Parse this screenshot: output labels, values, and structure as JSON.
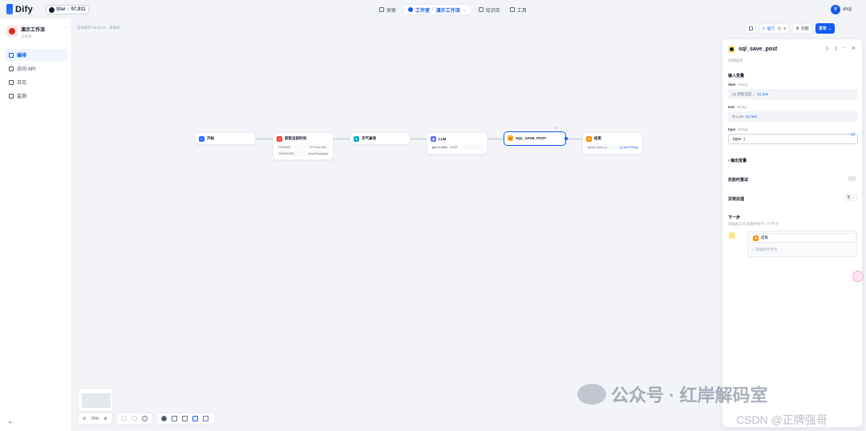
{
  "brand": {
    "name": "Dify",
    "star_label": "Star",
    "star_count": "97,911"
  },
  "nav": {
    "search": "探索",
    "studio": "工作室",
    "app_crumb": "演示工作流",
    "knowledge": "知识库",
    "tools": "工具"
  },
  "user": {
    "initial": "V",
    "name": "vhql"
  },
  "sidebar": {
    "app_name": "演示工作流",
    "app_type": "工作流",
    "items": [
      {
        "label": "编排",
        "icon": "layout-icon"
      },
      {
        "label": "访问 API",
        "icon": "api-icon"
      },
      {
        "label": "日志",
        "icon": "log-icon"
      },
      {
        "label": "监测",
        "icon": "monitor-icon"
      }
    ]
  },
  "canvas": {
    "autosave": "自动保存 09:24:11 · 未发布",
    "toolbar": {
      "run": "运行",
      "features": "功能",
      "publish": "发布"
    },
    "zoom": "76%"
  },
  "nodes": [
    {
      "id": "start",
      "title": "开始",
      "color": "#2970ff"
    },
    {
      "id": "http",
      "title": "获取当前时间",
      "color": "#f04438",
      "rows": [
        [
          "FORMAT",
          "%Y-%m-%d..."
        ],
        [
          "TIMEZONE",
          "Asia/Shanghai"
        ]
      ]
    },
    {
      "id": "weather",
      "title": "天气查询",
      "color": "#06aed4"
    },
    {
      "id": "llm",
      "title": "LLM",
      "color": "#6172f3",
      "rows": [
        [
          "glm-4-flash",
          "CHAT"
        ]
      ]
    },
    {
      "id": "sql",
      "title": "SQL_SAVE_POST",
      "color": "#fdb022"
    },
    {
      "id": "end",
      "title": "结束",
      "color": "#f79009",
      "rows": [
        [
          "{x}sql_save_p...",
          "{x} text  String"
        ]
      ]
    }
  ],
  "panel": {
    "title": "sql_save_post",
    "desc_placeholder": "添加描述...",
    "input_section": "输入变量",
    "fields": [
      {
        "name": "date",
        "type": "String",
        "value": "{x} 获取当前...",
        "var": "{x} text"
      },
      {
        "name": "text",
        "type": "String",
        "value": "⚙ LLM",
        "var": "{x} text"
      },
      {
        "name": "type",
        "type": "String",
        "value": "type"
      }
    ],
    "output_section": "输出变量",
    "retry_label": "失败时重试",
    "error_label": "异常处理",
    "error_value": "无",
    "next_title": "下一步",
    "next_desc": "添加此工作流程中的下一个节点",
    "next_node": "结束",
    "add_parallel": "添加并行节点"
  },
  "watermark": {
    "line1": "公众号 · 红岸解码室",
    "line2": "CSDN @正牌强哥"
  }
}
